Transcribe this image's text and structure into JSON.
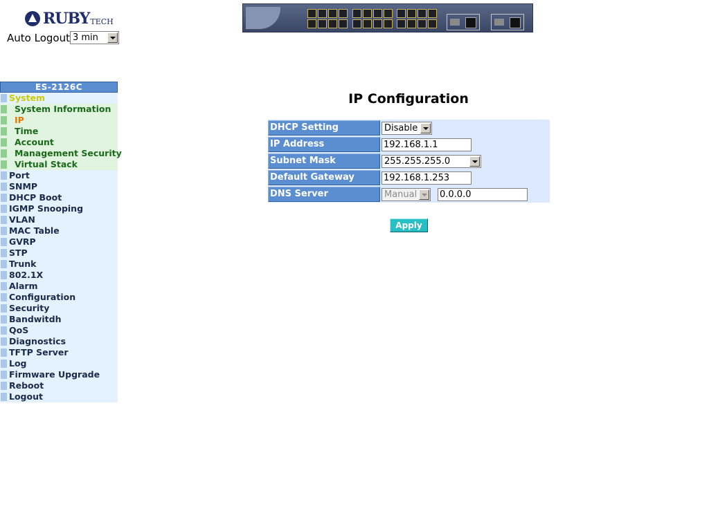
{
  "brand": {
    "name": "RUBY",
    "suffix": "TECH"
  },
  "auto_logout": {
    "label": "Auto Logout",
    "value": "3 min"
  },
  "sidebar": {
    "header": "ES-2126C",
    "items": [
      {
        "label": "System",
        "kind": "system"
      },
      {
        "label": "System Information",
        "kind": "sub"
      },
      {
        "label": "IP",
        "kind": "sub-active"
      },
      {
        "label": "Time",
        "kind": "sub"
      },
      {
        "label": "Account",
        "kind": "sub"
      },
      {
        "label": "Management Security",
        "kind": "sub"
      },
      {
        "label": "Virtual Stack",
        "kind": "sub"
      },
      {
        "label": "Port",
        "kind": "top"
      },
      {
        "label": "SNMP",
        "kind": "top"
      },
      {
        "label": "DHCP Boot",
        "kind": "top"
      },
      {
        "label": "IGMP Snooping",
        "kind": "top"
      },
      {
        "label": "VLAN",
        "kind": "top"
      },
      {
        "label": "MAC Table",
        "kind": "top"
      },
      {
        "label": "GVRP",
        "kind": "top"
      },
      {
        "label": "STP",
        "kind": "top"
      },
      {
        "label": "Trunk",
        "kind": "top"
      },
      {
        "label": "802.1X",
        "kind": "top"
      },
      {
        "label": "Alarm",
        "kind": "top"
      },
      {
        "label": "Configuration",
        "kind": "top"
      },
      {
        "label": "Security",
        "kind": "top"
      },
      {
        "label": "Bandwitdh",
        "kind": "top"
      },
      {
        "label": "QoS",
        "kind": "top"
      },
      {
        "label": "Diagnostics",
        "kind": "top"
      },
      {
        "label": "TFTP Server",
        "kind": "top"
      },
      {
        "label": "Log",
        "kind": "top"
      },
      {
        "label": "Firmware Upgrade",
        "kind": "top"
      },
      {
        "label": "Reboot",
        "kind": "top"
      },
      {
        "label": "Logout",
        "kind": "top"
      }
    ]
  },
  "page": {
    "title": "IP Configuration",
    "dhcp": {
      "label": "DHCP Setting",
      "value": "Disable"
    },
    "ip": {
      "label": "IP Address",
      "value": "192.168.1.1"
    },
    "mask": {
      "label": "Subnet Mask",
      "value": "255.255.255.0"
    },
    "gateway": {
      "label": "Default Gateway",
      "value": "192.168.1.253"
    },
    "dns": {
      "label": "DNS Server",
      "mode": "Manual",
      "value": "0.0.0.0"
    },
    "apply_label": "Apply"
  },
  "colors": {
    "nav_header": "#5b8ed0",
    "row_bg": "#dde9ff",
    "apply": "#27bfc4",
    "active_item": "#e07a00"
  }
}
